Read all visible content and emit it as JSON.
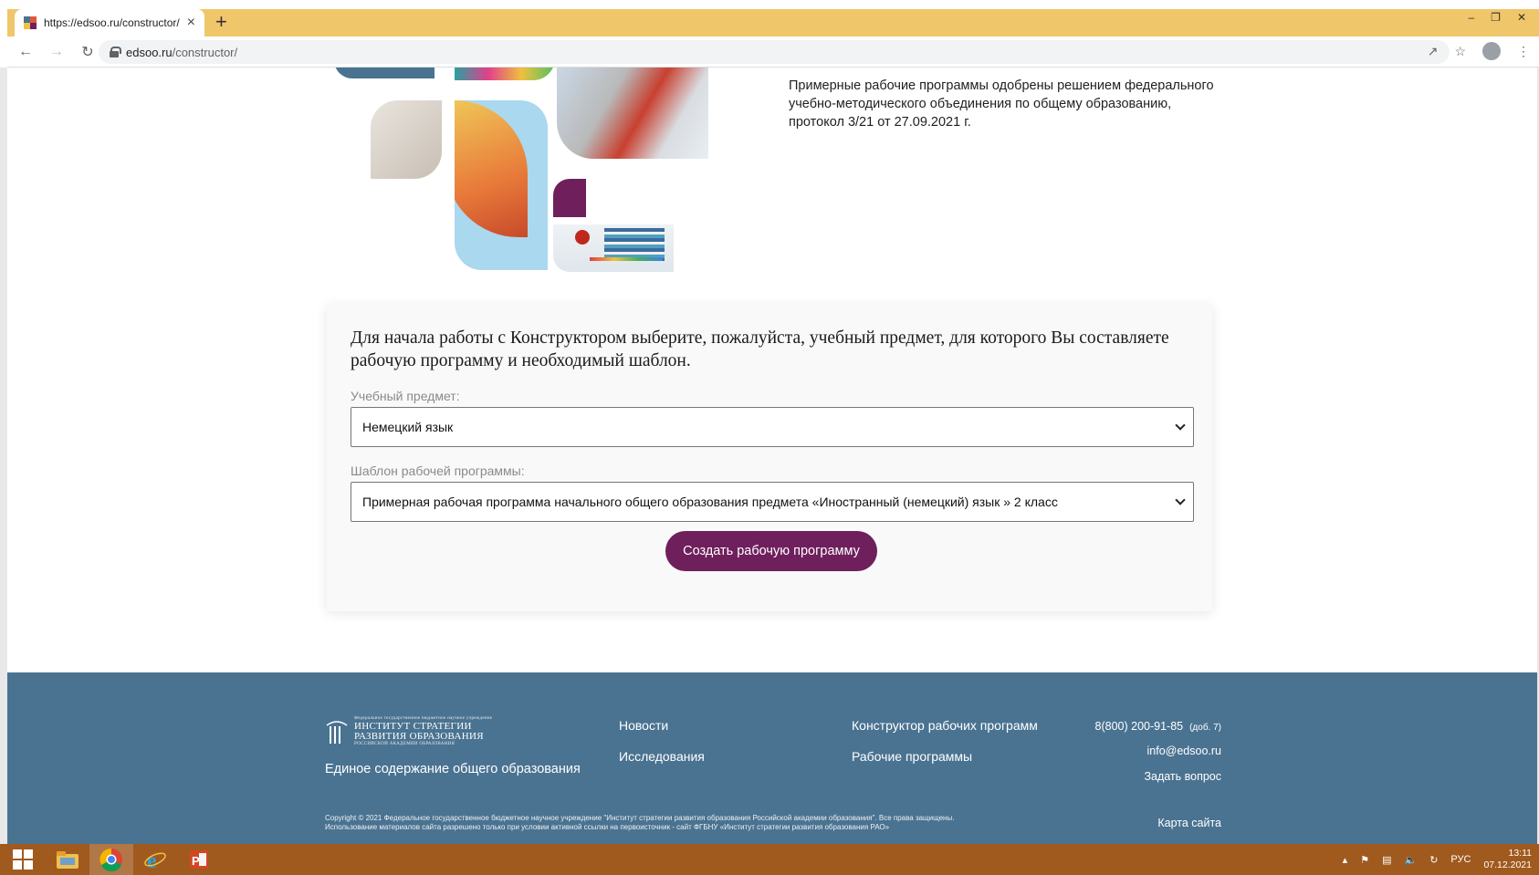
{
  "browser": {
    "tab_title": "https://edsoo.ru/constructor/",
    "url_host": "edsoo.ru",
    "url_path": "/constructor/",
    "new_tab": "+",
    "close": "×"
  },
  "intro": {
    "text": "Примерные рабочие программы одобрены решением федерального учебно-методического объединения по общему образованию, протокол 3/21 от 27.09.2021 г."
  },
  "form": {
    "heading": "Для начала работы с Конструктором выберите, пожалуйста, учебный предмет, для которого Вы составляете рабочую программу и необходимый шаблон.",
    "subject_label": "Учебный предмет:",
    "subject_value": "Немецкий язык",
    "template_label": "Шаблон рабочей программы:",
    "template_value": "Примерная рабочая программа начального общего образования предмета «Иностранный (немецкий) язык » 2 класс",
    "submit_label": "Создать рабочую программу"
  },
  "footer": {
    "logo_small": "Федеральное государственное бюджетное научное учреждение",
    "logo_line1": "ИНСТИТУТ СТРАТЕГИИ",
    "logo_line2": "РАЗВИТИЯ ОБРАЗОВАНИЯ",
    "logo_line3": "РОССИЙСКОЙ АКАДЕМИИ ОБРАЗОВАНИЯ",
    "tagline": "Единое содержание общего образования",
    "links": {
      "news": "Новости",
      "research": "Исследования",
      "constructor": "Конструктор рабочих программ",
      "programs": "Рабочие программы"
    },
    "phone": "8(800) 200-91-85",
    "phone_ext": "(доб. 7)",
    "email": "info@edsoo.ru",
    "ask": "Задать вопрос",
    "sitemap": "Карта сайта",
    "copyright_1": "Copyright © 2021 Федеральное государственное бюджетное научное учреждение \"Институт стратегии развития образования Российской академии образования\". Все права защищены.",
    "copyright_2": "Использование материалов сайта разрешено только при условии активной ссылки на первоисточник - сайт ФГБНУ «Институт стратегии развития образования РАО»"
  },
  "taskbar": {
    "lang": "РУС",
    "time": "13:11",
    "date": "07.12.2021"
  },
  "colors": {
    "accent": "#6e1f5c",
    "footer_bg": "#4a7391",
    "tabstrip": "#f0c66a",
    "taskbar": "#a05a1e"
  }
}
